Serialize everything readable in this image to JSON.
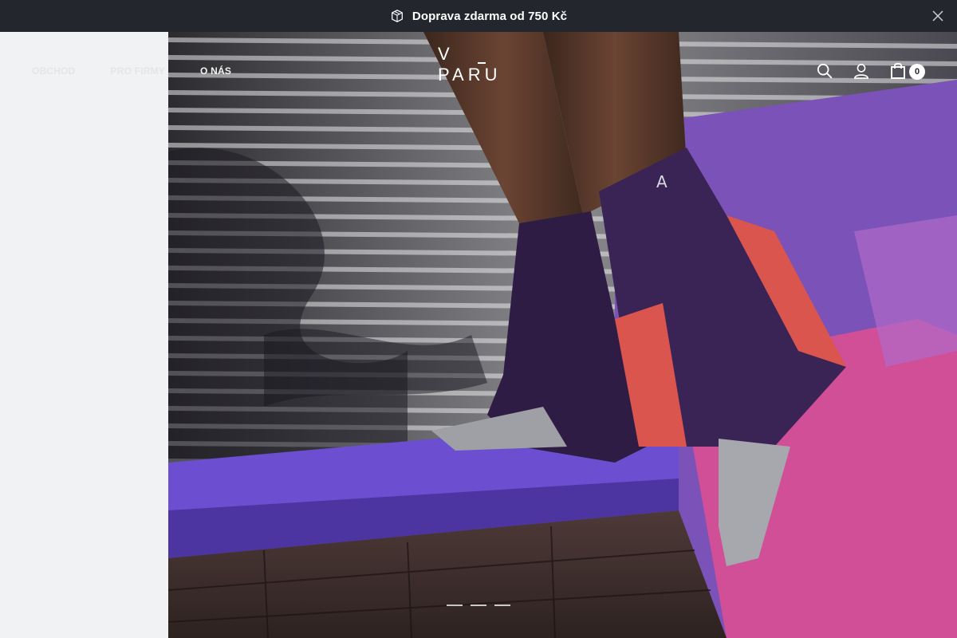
{
  "announcement": {
    "text": "Doprava zdarma od 750 Kč",
    "icon": "package-icon",
    "close_icon": "close-icon"
  },
  "nav": {
    "items": [
      {
        "label": "OBCHOD"
      },
      {
        "label": "PRO FIRMY"
      },
      {
        "label": "O NÁS"
      }
    ]
  },
  "logo": {
    "text": "V PARU"
  },
  "header_icons": {
    "search": "search-icon",
    "account": "user-icon",
    "cart": "cart-icon",
    "cart_count": "0"
  },
  "slider": {
    "slides_count": "3"
  },
  "colors": {
    "topbar": "#24262e",
    "sock_purple": "#3a2456",
    "sock_coral": "#d9554e",
    "sock_grey": "#a7a8ad",
    "sill_purple": "#6d4fd0",
    "graffiti_pink": "#e0559f"
  }
}
